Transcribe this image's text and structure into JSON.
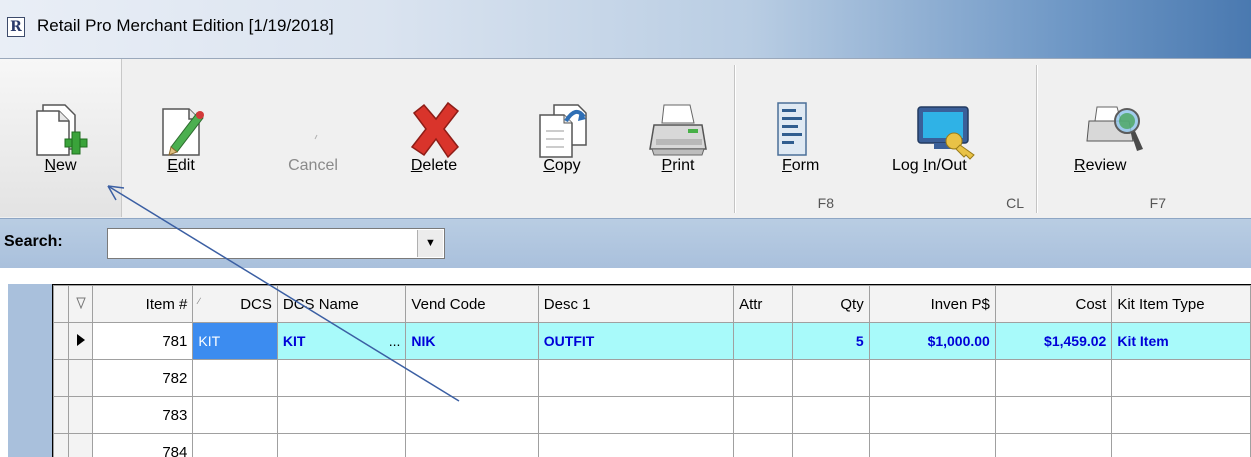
{
  "window": {
    "title": "Retail Pro Merchant Edition [1/19/2018]",
    "app_icon": "retail-pro-logo-icon"
  },
  "toolbar": {
    "buttons": [
      {
        "id": "new",
        "label": "New",
        "accel": "N",
        "icon": "new-document-plus-icon",
        "pressed": true,
        "enabled": true,
        "hotkey": ""
      },
      {
        "id": "edit",
        "label": "Edit",
        "accel": "E",
        "icon": "edit-pencil-icon",
        "pressed": false,
        "enabled": true,
        "hotkey": ""
      },
      {
        "id": "cancel",
        "label": "Cancel",
        "accel": "",
        "icon": "cancel-icon",
        "pressed": false,
        "enabled": false,
        "hotkey": ""
      },
      {
        "id": "delete",
        "label": "Delete",
        "accel": "D",
        "icon": "delete-x-icon",
        "pressed": false,
        "enabled": true,
        "hotkey": ""
      },
      {
        "id": "copy",
        "label": "Copy",
        "accel": "C",
        "icon": "copy-document-icon",
        "pressed": false,
        "enabled": true,
        "hotkey": ""
      },
      {
        "id": "print",
        "label": "Print",
        "accel": "P",
        "icon": "printer-icon",
        "pressed": false,
        "enabled": true,
        "hotkey": ""
      },
      {
        "id": "form",
        "label": "Form",
        "accel": "F",
        "icon": "form-document-icon",
        "pressed": false,
        "enabled": true,
        "hotkey": "F8"
      },
      {
        "id": "login",
        "label": "Log In/Out",
        "accel": "I",
        "icon": "monitor-key-icon",
        "pressed": false,
        "enabled": true,
        "hotkey": "CL"
      },
      {
        "id": "review",
        "label": "Review",
        "accel": "R",
        "icon": "printer-magnifier-icon",
        "pressed": false,
        "enabled": true,
        "hotkey": "F7"
      }
    ]
  },
  "search": {
    "label": "Search:",
    "value": "",
    "dropdown_icon": "chevron-down-icon"
  },
  "grid": {
    "columns": [
      "",
      "Item #",
      "DCS",
      "DCS Name",
      "Vend Code",
      "Desc 1",
      "Attr",
      "Qty",
      "Inven P$",
      "Cost",
      "Kit Item Type"
    ],
    "rows": [
      {
        "item_no": "781",
        "dcs": "KIT",
        "dcs_name": "KIT",
        "dcs_name_more": "...",
        "vend_code": "NIK",
        "desc1": "OUTFIT",
        "attr": "",
        "qty": "5",
        "inven_p": "$1,000.00",
        "cost": "$1,459.02",
        "kit_type": "Kit Item",
        "current": true
      },
      {
        "item_no": "782",
        "dcs": "",
        "dcs_name": "",
        "dcs_name_more": "",
        "vend_code": "",
        "desc1": "",
        "attr": "",
        "qty": "",
        "inven_p": "",
        "cost": "",
        "kit_type": "",
        "current": false
      },
      {
        "item_no": "783",
        "dcs": "",
        "dcs_name": "",
        "dcs_name_more": "",
        "vend_code": "",
        "desc1": "",
        "attr": "",
        "qty": "",
        "inven_p": "",
        "cost": "",
        "kit_type": "",
        "current": false
      },
      {
        "item_no": "784",
        "dcs": "",
        "dcs_name": "",
        "dcs_name_more": "",
        "vend_code": "",
        "desc1": "",
        "attr": "",
        "qty": "",
        "inven_p": "",
        "cost": "",
        "kit_type": "",
        "current": false
      }
    ]
  },
  "colors": {
    "selected_row": "#a8fafa",
    "selected_cell": "#3c8cf0",
    "selected_text": "#0000d8",
    "toolbar_bg": "#f0f0f0",
    "accent_band": "#a9c0dc",
    "annotation_arrow": "#3b5fa3"
  }
}
